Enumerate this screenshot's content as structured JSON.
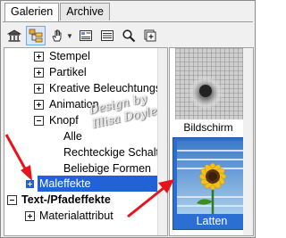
{
  "tabs": [
    {
      "label": "Galerien",
      "active": true
    },
    {
      "label": "Archive",
      "active": false
    }
  ],
  "toolbar": {
    "icons": [
      "library-icon",
      "tree-view-icon",
      "hand-icon",
      "dropdown-arrow-icon",
      "tile-view-icon",
      "details-icon",
      "search-icon",
      "add-gallery-icon"
    ]
  },
  "tree": {
    "items": [
      {
        "label": "Stempel",
        "expander": "plus",
        "indent": 1
      },
      {
        "label": "Partikel",
        "expander": "plus",
        "indent": 1
      },
      {
        "label": "Kreative Beleuchtungs",
        "expander": "plus",
        "indent": 1
      },
      {
        "label": "Animation",
        "expander": "plus",
        "indent": 1
      },
      {
        "label": "Knopf",
        "expander": "minus",
        "indent": 1
      },
      {
        "label": "Alle",
        "expander": "none",
        "indent": 2
      },
      {
        "label": "Rechteckige Schalt",
        "expander": "none",
        "indent": 2
      },
      {
        "label": "Beliebige Formen",
        "expander": "none",
        "indent": 2
      },
      {
        "label": "Maleffekte",
        "expander": "plus",
        "indent": 1,
        "selected": true
      },
      {
        "label": "Text-/Pfadeffekte",
        "expander": "minus",
        "indent": 0,
        "group": true
      },
      {
        "label": "Materialattribut",
        "expander": "plus",
        "indent": 1
      }
    ]
  },
  "thumbnails": [
    {
      "caption": "Bildschirm",
      "selected": false
    },
    {
      "caption": "Latten",
      "selected": true
    }
  ],
  "watermark": {
    "line1": "Design by",
    "line2": "Illisa Doyle"
  },
  "colors": {
    "selection": "#1f63d6",
    "arrow": "#e8141b"
  }
}
